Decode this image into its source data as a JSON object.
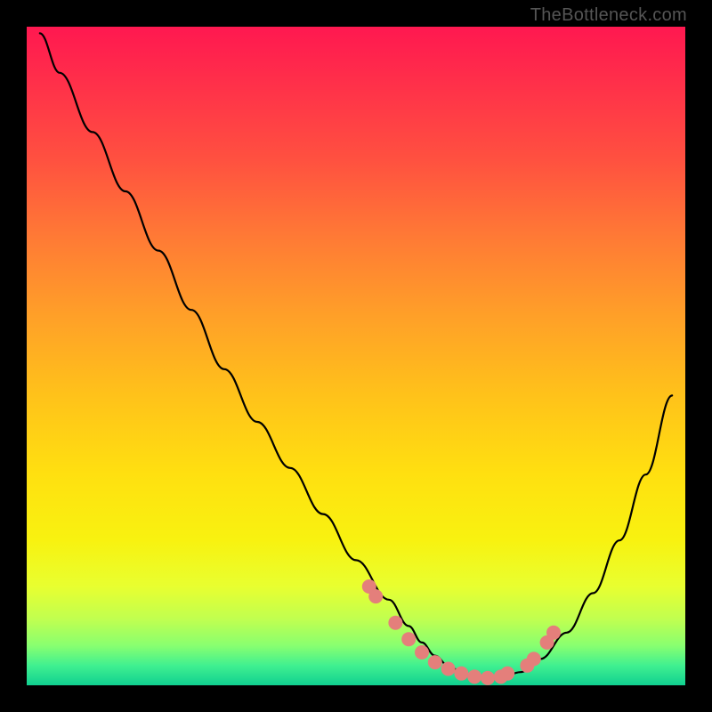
{
  "watermark": "TheBottleneck.com",
  "colors": {
    "curve": "#000000",
    "dot": "#e47f7b",
    "background": "#000000"
  },
  "chart_data": {
    "type": "line",
    "title": "",
    "xlabel": "",
    "ylabel": "",
    "xlim": [
      0,
      100
    ],
    "ylim": [
      0,
      100
    ],
    "grid": false,
    "series": [
      {
        "name": "bottleneck-curve",
        "x": [
          2,
          5,
          10,
          15,
          20,
          25,
          30,
          35,
          40,
          45,
          50,
          55,
          58,
          60,
          62,
          64,
          66,
          68,
          70,
          72,
          75,
          78,
          82,
          86,
          90,
          94,
          98
        ],
        "y": [
          99,
          93,
          84,
          75,
          66,
          57,
          48,
          40,
          33,
          26,
          19,
          13,
          9,
          6.5,
          4.5,
          3,
          2,
          1.3,
          1,
          1.2,
          2,
          4,
          8,
          14,
          22,
          32,
          44
        ]
      }
    ],
    "points": {
      "name": "highlight-dots",
      "x": [
        52,
        53,
        56,
        58,
        60,
        62,
        64,
        66,
        68,
        70,
        72,
        73,
        76,
        77,
        79,
        80
      ],
      "y": [
        15,
        13.5,
        9.5,
        7,
        5,
        3.5,
        2.5,
        1.8,
        1.3,
        1.1,
        1.3,
        1.8,
        3,
        4,
        6.5,
        8
      ]
    }
  }
}
